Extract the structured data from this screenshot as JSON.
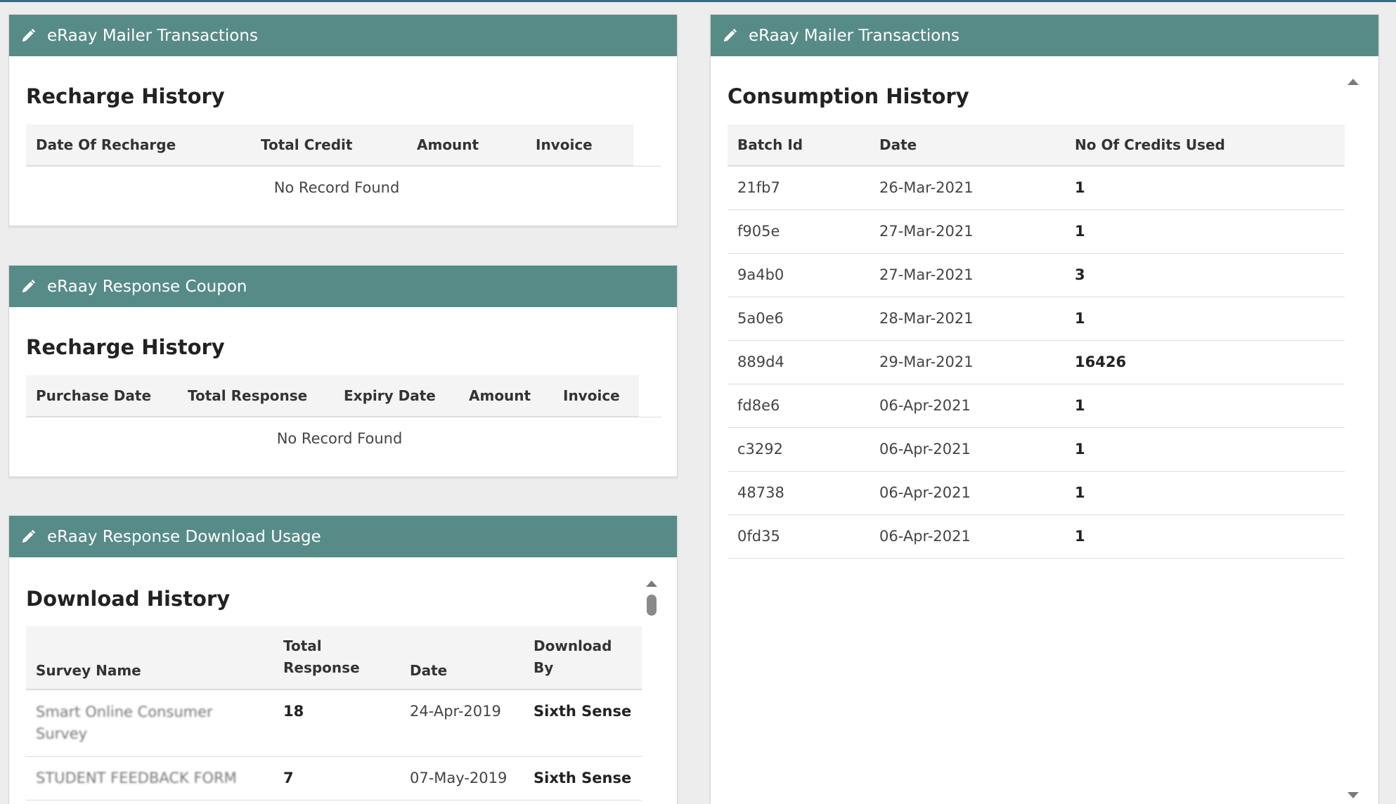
{
  "mailer_panel": {
    "header": "eRaay Mailer Transactions",
    "section_title": "Recharge History",
    "columns": [
      "Date Of Recharge",
      "Total Credit",
      "Amount",
      "Invoice"
    ],
    "empty_text": "No Record Found"
  },
  "coupon_panel": {
    "header": "eRaay Response Coupon",
    "section_title": "Recharge History",
    "columns": [
      "Purchase Date",
      "Total Response",
      "Expiry Date",
      "Amount",
      "Invoice"
    ],
    "empty_text": "No Record Found"
  },
  "download_panel": {
    "header": "eRaay Response Download Usage",
    "section_title": "Download History",
    "columns": [
      "Survey Name",
      "Total Response",
      "Date",
      "Download By"
    ],
    "rows": [
      {
        "survey_name": "Smart Online Consumer Survey",
        "total_response": "18",
        "date": "24-Apr-2019",
        "download_by": "Sixth Sense"
      },
      {
        "survey_name": "STUDENT FEEDBACK FORM",
        "total_response": "7",
        "date": "07-May-2019",
        "download_by": "Sixth Sense"
      }
    ]
  },
  "consumption_panel": {
    "header": "eRaay Mailer Transactions",
    "section_title": "Consumption History",
    "columns": [
      "Batch Id",
      "Date",
      "No Of Credits Used"
    ],
    "rows": [
      {
        "batch_id": "21fb7",
        "date": "26-Mar-2021",
        "credits": "1"
      },
      {
        "batch_id": "f905e",
        "date": "27-Mar-2021",
        "credits": "1"
      },
      {
        "batch_id": "9a4b0",
        "date": "27-Mar-2021",
        "credits": "3"
      },
      {
        "batch_id": "5a0e6",
        "date": "28-Mar-2021",
        "credits": "1"
      },
      {
        "batch_id": "889d4",
        "date": "29-Mar-2021",
        "credits": "16426"
      },
      {
        "batch_id": "fd8e6",
        "date": "06-Apr-2021",
        "credits": "1"
      },
      {
        "batch_id": "c3292",
        "date": "06-Apr-2021",
        "credits": "1"
      },
      {
        "batch_id": "48738",
        "date": "06-Apr-2021",
        "credits": "1"
      },
      {
        "batch_id": "0fd35",
        "date": "06-Apr-2021",
        "credits": "1"
      }
    ]
  },
  "icons": {
    "header_icon": "pencil-icon"
  },
  "colors": {
    "header_bg": "#578b88",
    "top_line": "#2e6e8e"
  }
}
